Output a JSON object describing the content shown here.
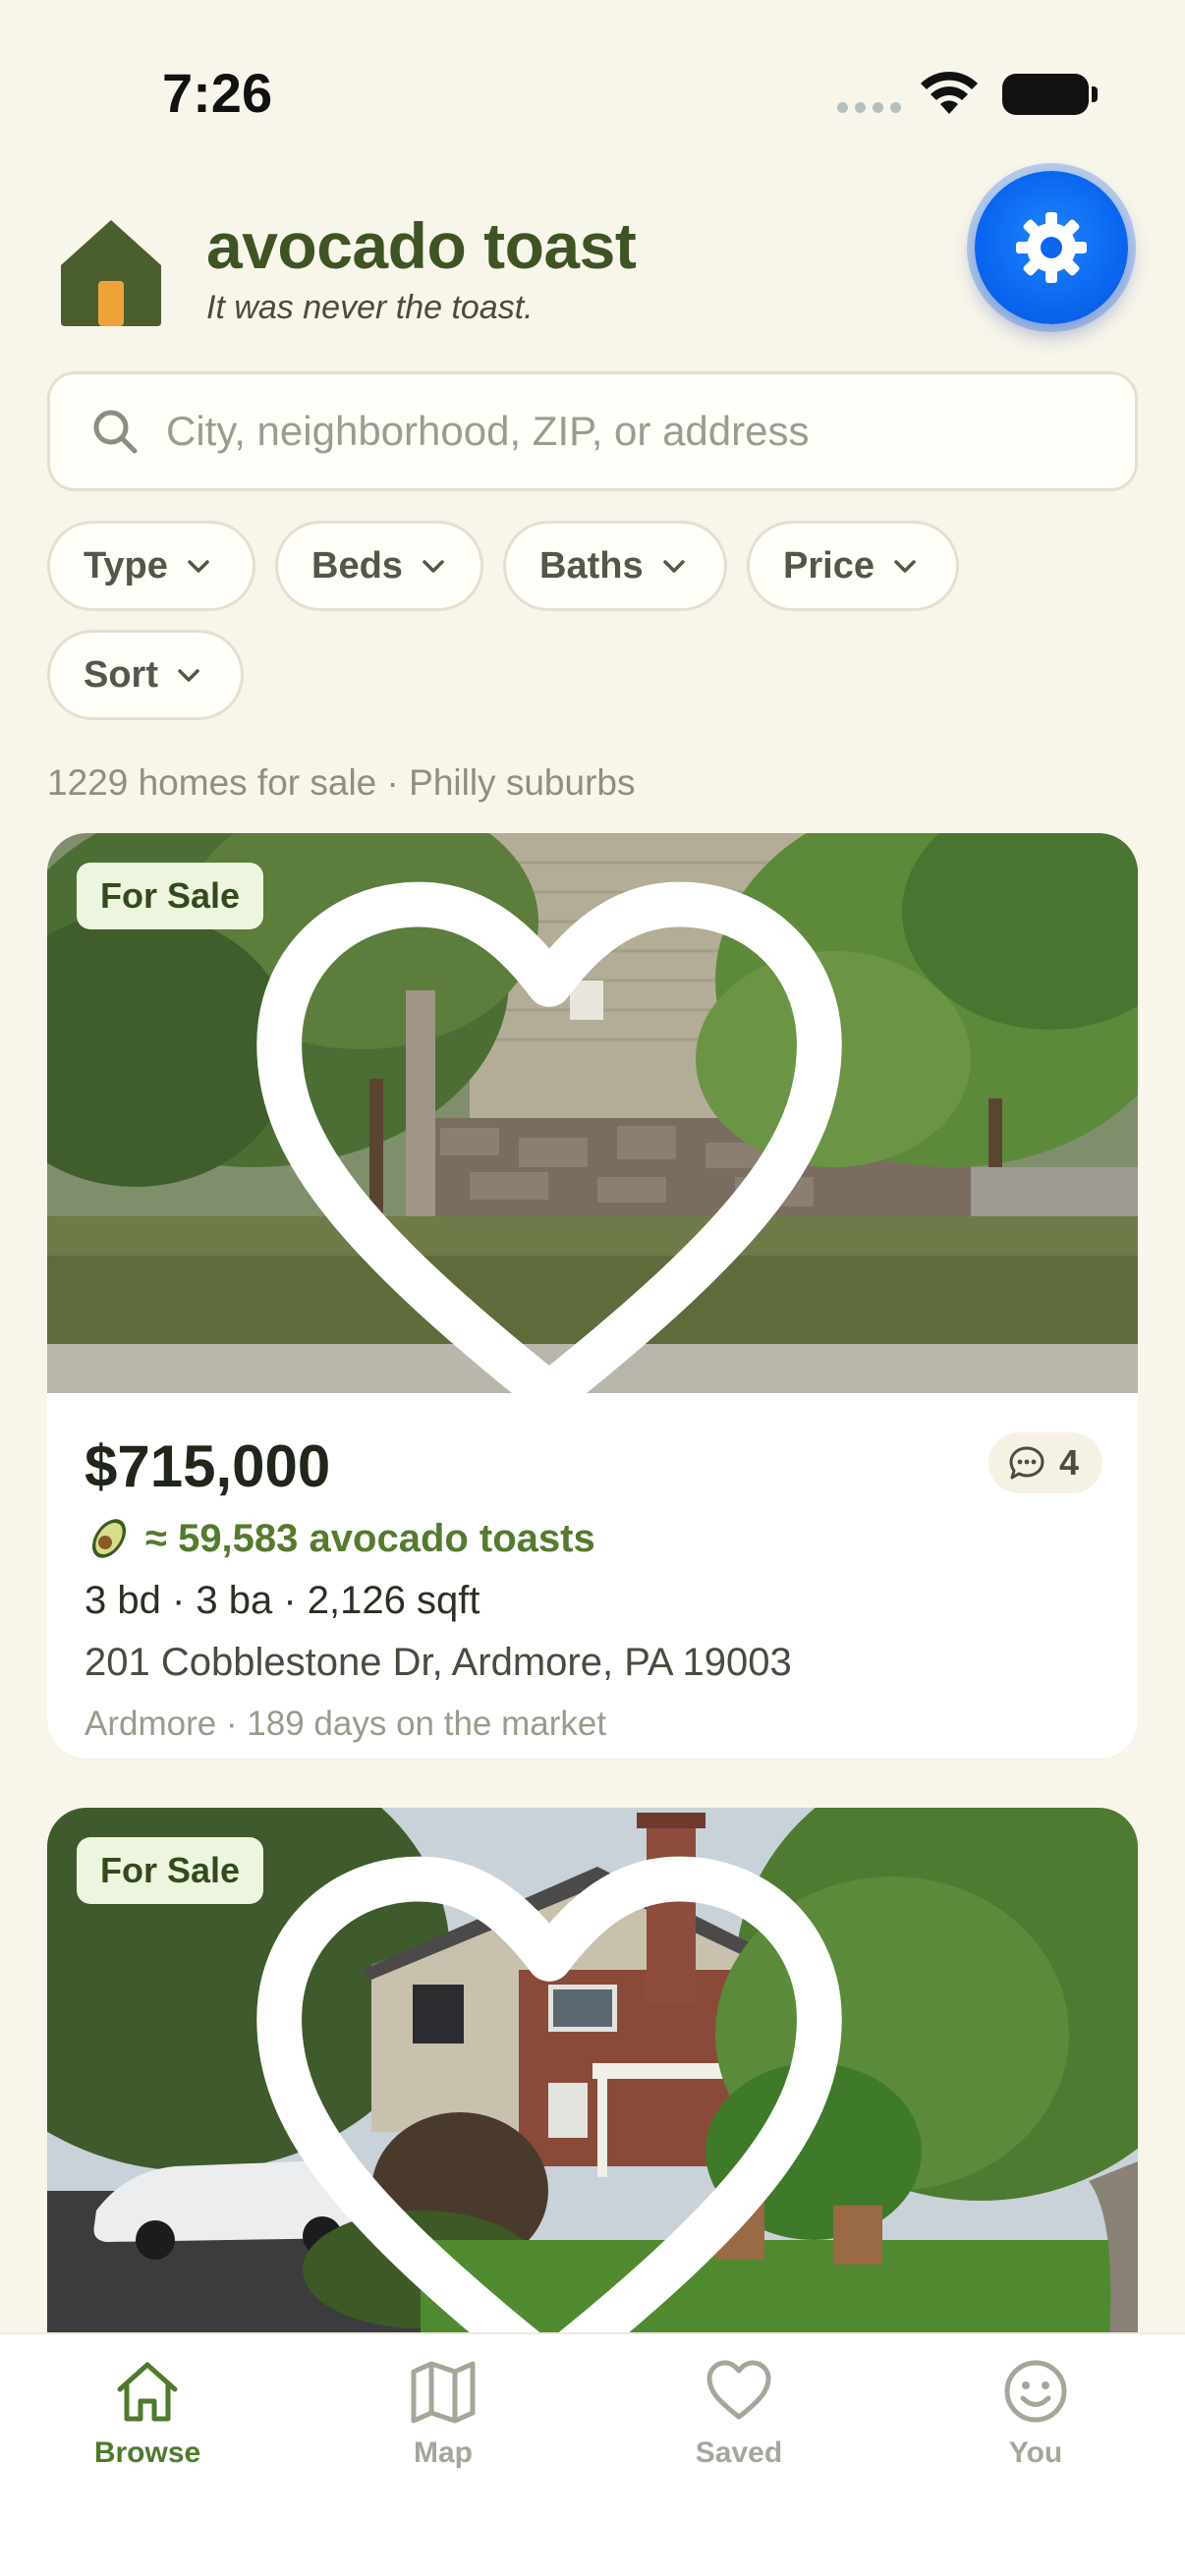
{
  "status_bar": {
    "time": "7:26"
  },
  "header": {
    "title": "avocado toast",
    "tagline": "It was never the toast.",
    "settings_icon": "gear-icon"
  },
  "search": {
    "placeholder": "City, neighborhood, ZIP, or address",
    "value": ""
  },
  "filters": [
    {
      "label": "Type"
    },
    {
      "label": "Beds"
    },
    {
      "label": "Baths"
    },
    {
      "label": "Price"
    },
    {
      "label": "Sort"
    }
  ],
  "results_summary": "1229 homes for sale · Philly suburbs",
  "listings": [
    {
      "status": "For Sale",
      "price": "$715,000",
      "toast_equivalent": "≈ 59,583 avocado toasts",
      "specs": "3 bd · 3 ba · 2,126 sqft",
      "address": "201 Cobblestone Dr, Ardmore, PA 19003",
      "meta": "Ardmore · 189 days on the market",
      "comments": "4",
      "saved": false
    },
    {
      "status": "For Sale",
      "saved": false
    }
  ],
  "tab_bar": {
    "items": [
      {
        "label": "Browse",
        "icon": "house-icon",
        "active": true
      },
      {
        "label": "Map",
        "icon": "map-icon",
        "active": false
      },
      {
        "label": "Saved",
        "icon": "heart-icon",
        "active": false
      },
      {
        "label": "You",
        "icon": "smiley-icon",
        "active": false
      }
    ]
  },
  "colors": {
    "background": "#f8f5ea",
    "brand_green": "#3e5424",
    "accent_blue": "#0a66f0",
    "toast_green": "#567a2c",
    "tag_background": "#edf5de"
  }
}
